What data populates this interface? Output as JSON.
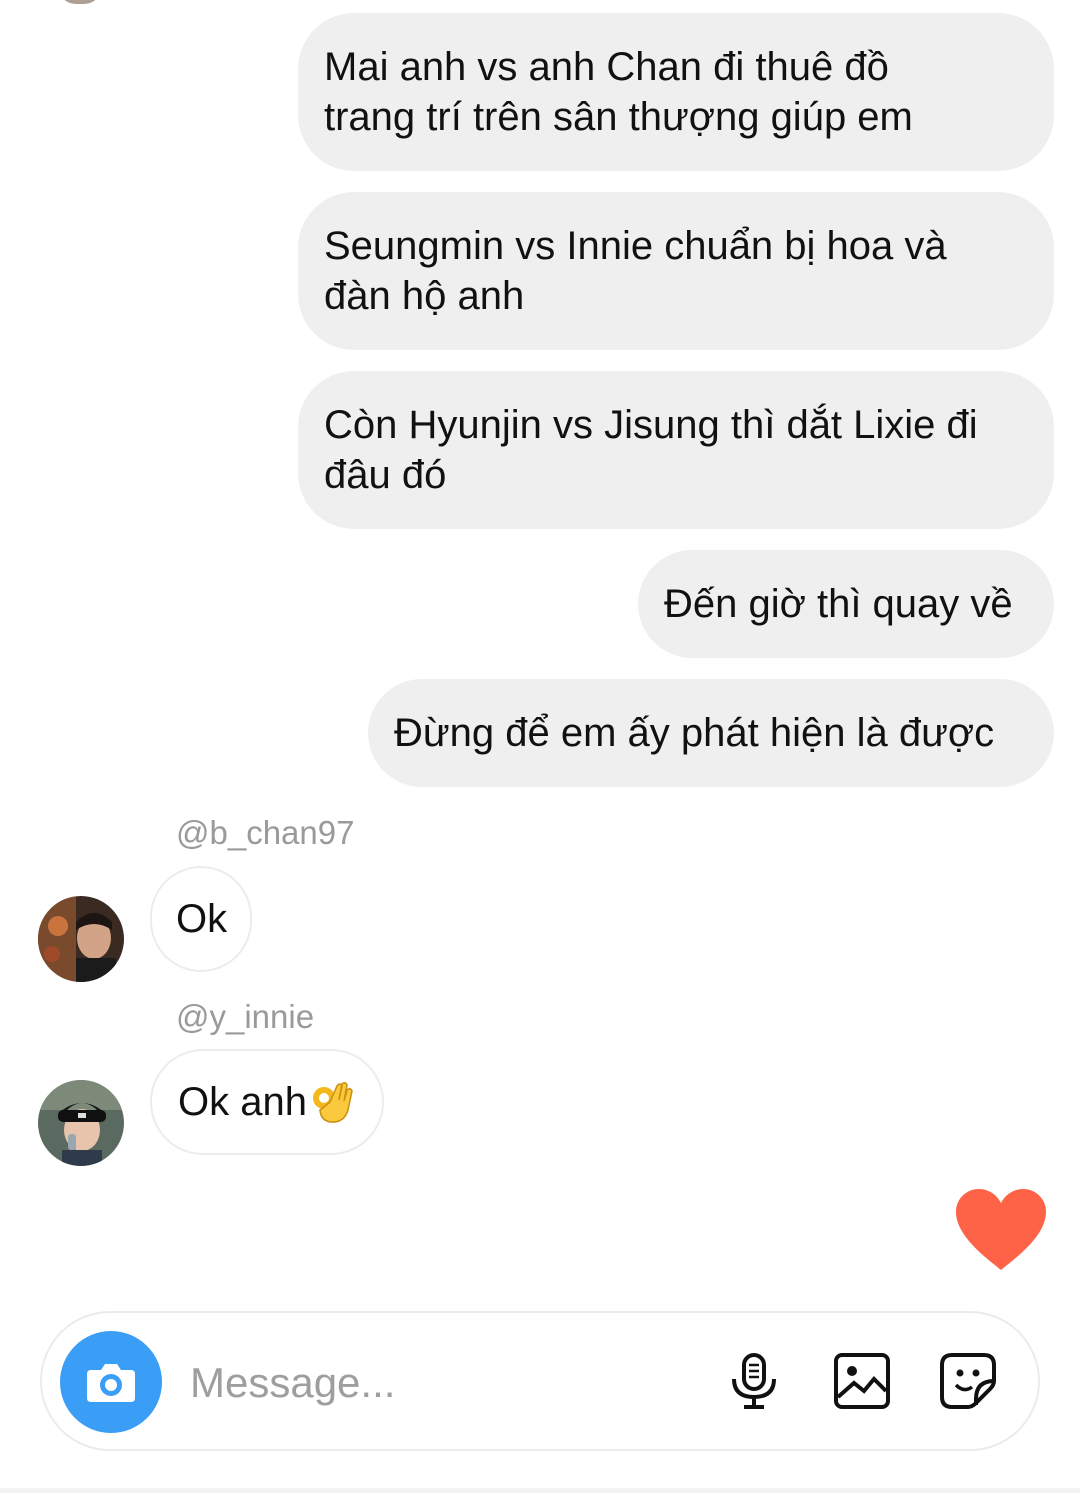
{
  "thread": {
    "outgoing": [
      {
        "lines": [
          "Mai anh vs anh Chan đi thuê đồ",
          "trang trí trên sân thượng giúp em"
        ]
      },
      {
        "lines": [
          "Seungmin vs Innie chuẩn bị hoa và",
          "đàn hộ anh"
        ]
      },
      {
        "lines": [
          "Còn Hyunjin vs Jisung thì dắt Lixie đi",
          "đâu đó"
        ]
      },
      {
        "lines": [
          "Đến giờ thì quay về"
        ]
      },
      {
        "lines": [
          "Đừng để em ấy phát hiện là được"
        ]
      }
    ],
    "incoming": [
      {
        "sender": "@b_chan97",
        "text": "Ok"
      },
      {
        "sender": "@y_innie",
        "text": "Ok anh",
        "emoji": "ok-hand-emoji"
      }
    ]
  },
  "quick_reaction": {
    "icon": "heart-icon",
    "color": "#fe6347"
  },
  "composer": {
    "placeholder": "Message...",
    "camera_icon": "camera-icon",
    "camera_color": "#3a9df6",
    "tools": [
      "microphone-icon",
      "gallery-icon",
      "sticker-icon"
    ]
  }
}
